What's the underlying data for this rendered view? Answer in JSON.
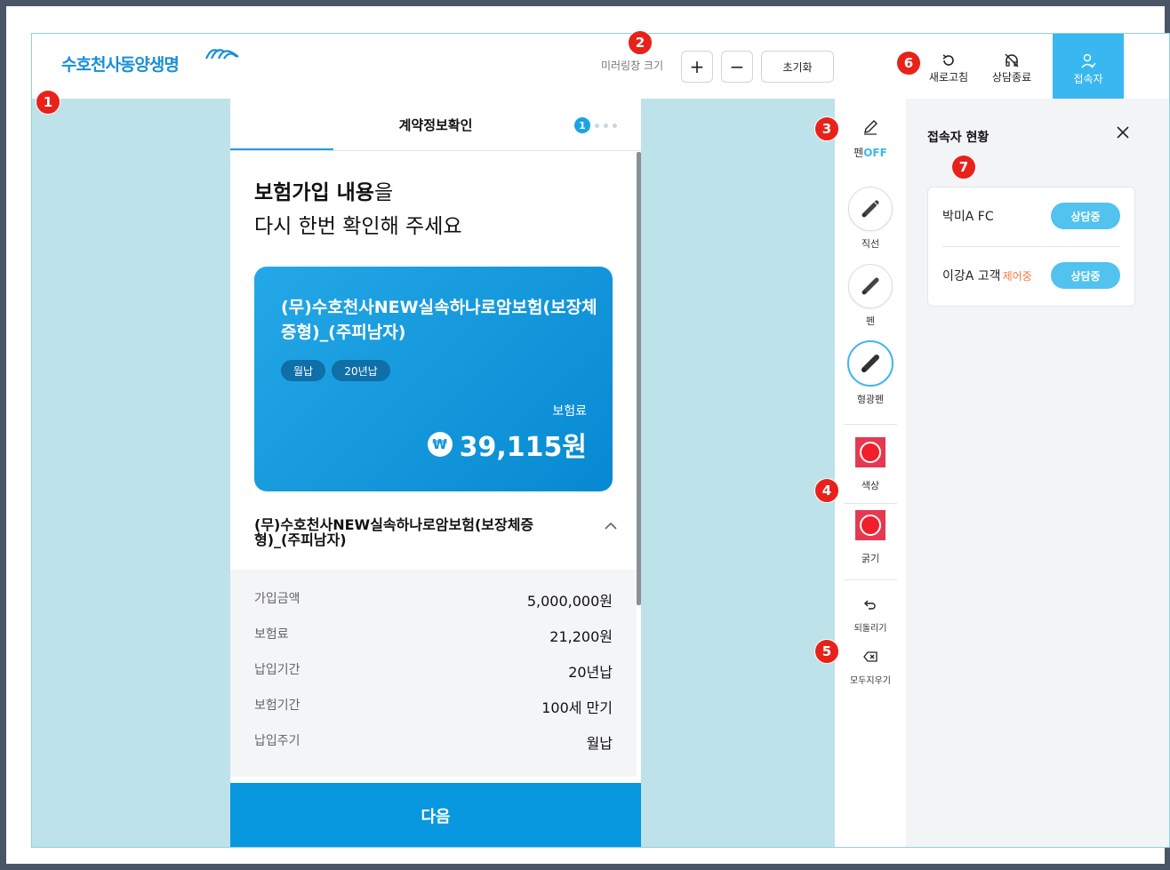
{
  "header": {
    "logo_text": "수호천사동양생명",
    "mirror_size_label": "미러링창 크기",
    "zoom_in": "+",
    "zoom_out": "−",
    "reset_label": "초기화",
    "refresh_label": "새로고침",
    "end_consult_label": "상담종료",
    "participants_label": "접속자"
  },
  "phone": {
    "tab_title": "계약정보확인",
    "step_current": "1",
    "heading_bold": "보험가입 내용",
    "heading_suffix": "을",
    "heading_line2": "다시 한번 확인해 주세요",
    "card": {
      "product_title": "(무)수호천사NEW실속하나로암보험(보장체증형)_(주피남자)",
      "chips": [
        "월납",
        "20년납"
      ],
      "premium_label": "보험료",
      "currency_icon": "₩",
      "premium_amount": "39,115원"
    },
    "product_name": "(무)수호천사NEW실속하나로암보험(보장체증형)_(주피남자)",
    "details": [
      {
        "label": "가입금액",
        "value": "5,000,000원"
      },
      {
        "label": "보험료",
        "value": "21,200원"
      },
      {
        "label": "납입기간",
        "value": "20년납"
      },
      {
        "label": "보험기간",
        "value": "100세 만기"
      },
      {
        "label": "납입주기",
        "value": "월납"
      }
    ],
    "next_label": "다음"
  },
  "toolbar": {
    "pen_toggle_prefix": "펜",
    "pen_toggle_state": "OFF",
    "line_label": "직선",
    "pen_label": "펜",
    "highlighter_label": "형광펜",
    "color_label": "색상",
    "thickness_label": "굵기",
    "undo_label": "되돌리기",
    "clear_label": "모두지우기",
    "accent_color": "#3fb6ec",
    "pen_color": "#f0202a"
  },
  "panel": {
    "title": "접속자 현황",
    "users": [
      {
        "name": "박미A FC",
        "tag": "",
        "status": "상담중"
      },
      {
        "name": "이강A 고객",
        "tag": "제어중",
        "status": "상담중"
      }
    ]
  },
  "badges": [
    "1",
    "2",
    "3",
    "4",
    "5",
    "6",
    "7"
  ]
}
